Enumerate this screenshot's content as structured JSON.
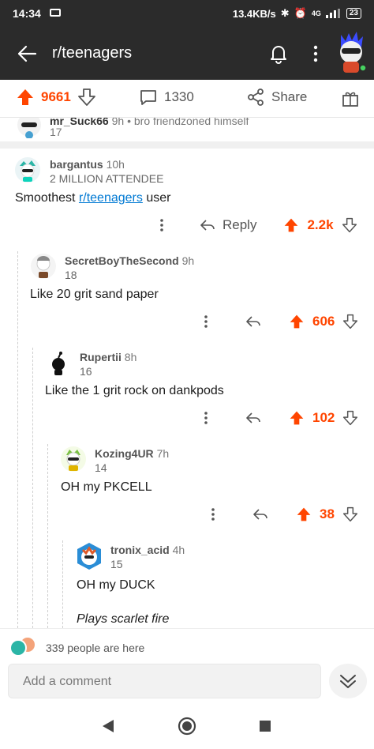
{
  "status": {
    "time": "14:34",
    "speed": "13.4KB/s",
    "network": "4G",
    "battery": "23"
  },
  "appbar": {
    "title": "r/teenagers"
  },
  "post_actions": {
    "upvotes": "9661",
    "comments": "1330",
    "share_label": "Share"
  },
  "prev_comment": {
    "user": "mr_Suck66",
    "age": "9h",
    "flair": "bro friendzoned himself",
    "points": "17"
  },
  "comments": [
    {
      "user": "bargantus",
      "age": "10h",
      "flair": "2 MILLION ATTENDEE",
      "body_pre": "Smoothest ",
      "body_link": "r/teenagers",
      "body_post": " user",
      "reply_label": "Reply",
      "score": "2.2k"
    },
    {
      "user": "SecretBoyTheSecond",
      "age": "9h",
      "points": "18",
      "body": "Like 20 grit sand paper",
      "score": "606"
    },
    {
      "user": "Rupertii",
      "age": "8h",
      "points": "16",
      "body": "Like the 1 grit rock on dankpods",
      "score": "102"
    },
    {
      "user": "Kozing4UR",
      "age": "7h",
      "points": "14",
      "body": "OH my PKCELL",
      "score": "38"
    },
    {
      "user": "tronix_acid",
      "age": "4h",
      "points": "15",
      "body": "OH my DUCK",
      "body2": "Plays scarlet fire"
    }
  ],
  "presence": {
    "text": "339 people are here"
  },
  "composer": {
    "placeholder": "Add a comment"
  },
  "colors": {
    "accent": "#ff4500",
    "link": "#0079d3",
    "appbar": "#2b2b2b"
  }
}
